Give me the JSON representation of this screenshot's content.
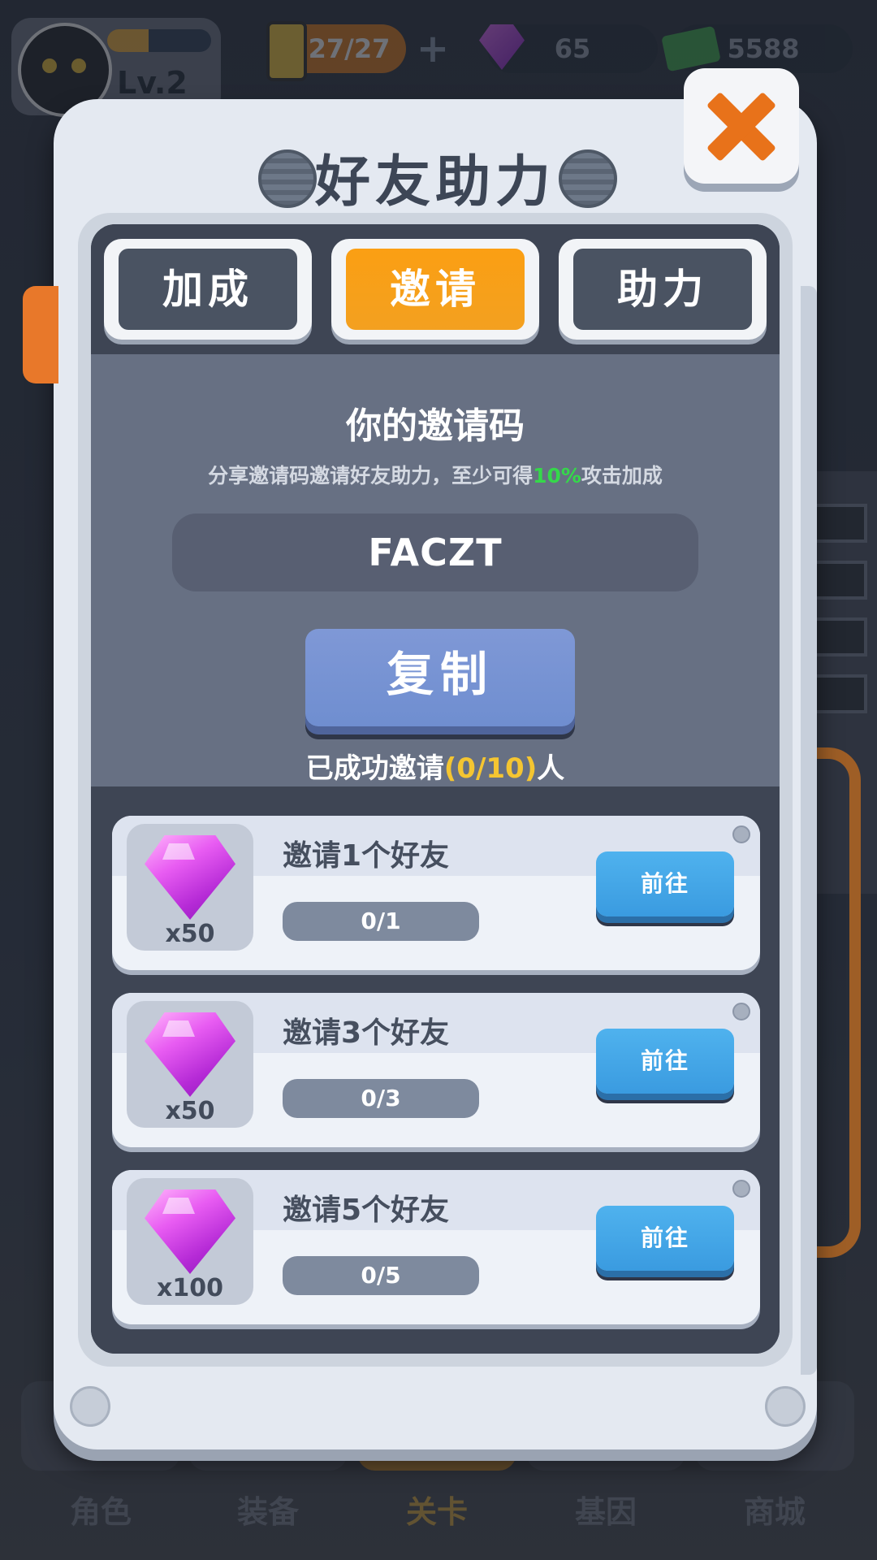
{
  "hud": {
    "level": "Lv.2",
    "xp_progress": 0.4,
    "energy": "27/27",
    "gems": "65",
    "cash": "5588"
  },
  "bottom_nav": {
    "items": [
      "角色",
      "装备",
      "关卡",
      "基因",
      "商城"
    ],
    "active_index": 2
  },
  "dialog": {
    "title": "好友助力",
    "tabs": [
      {
        "label": "加成",
        "active": false
      },
      {
        "label": "邀请",
        "active": true
      },
      {
        "label": "助力",
        "active": false
      }
    ],
    "invite": {
      "title": "你的邀请码",
      "desc_prefix": "分享邀请码邀请好友助力，至少可得",
      "desc_highlight": "10%",
      "desc_suffix": "攻击加成",
      "code": "FACZT",
      "copy_label": "复制",
      "success_prefix": "已成功邀请",
      "success_count": "(0/10)",
      "success_suffix": "人"
    },
    "tasks": [
      {
        "name": "邀请1个好友",
        "reward": "x50",
        "progress": "0/1",
        "progress_value": 0,
        "button": "前往"
      },
      {
        "name": "邀请3个好友",
        "reward": "x50",
        "progress": "0/3",
        "progress_value": 0,
        "button": "前往"
      },
      {
        "name": "邀请5个好友",
        "reward": "x100",
        "progress": "0/5",
        "progress_value": 0,
        "button": "前往"
      }
    ]
  },
  "colors": {
    "accent_orange": "#f39a1a",
    "highlight_green": "#35d84a",
    "highlight_yellow": "#f4c531",
    "go_button_blue": "#3a9be0",
    "copy_button_blue": "#7390d3"
  }
}
